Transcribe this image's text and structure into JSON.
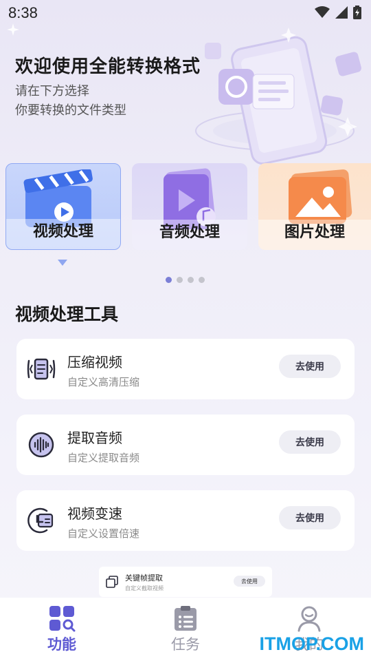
{
  "status_bar": {
    "time": "8:38"
  },
  "hero": {
    "title": "欢迎使用全能转换格式",
    "subtitle_line1": "请在下方选择",
    "subtitle_line2": "你要转换的文件类型"
  },
  "categories": [
    {
      "label": "视频处理",
      "selected": true
    },
    {
      "label": "音频处理",
      "selected": false
    },
    {
      "label": "图片处理",
      "selected": false
    }
  ],
  "carousel": {
    "page_count": 4,
    "active_index": 0
  },
  "section": {
    "title": "视频处理工具"
  },
  "tools": [
    {
      "name": "压缩视频",
      "desc": "自定义高清压缩",
      "button": "去使用",
      "icon": "compress-video-icon"
    },
    {
      "name": "提取音频",
      "desc": "自定义提取音频",
      "button": "去使用",
      "icon": "audio-wave-icon"
    },
    {
      "name": "视频变速",
      "desc": "自定义设置倍速",
      "button": "去使用",
      "icon": "speed-icon"
    }
  ],
  "mini_tool": {
    "name": "关键帧提取",
    "desc": "自定义截取视频",
    "button": "去使用",
    "icon": "keyframe-icon"
  },
  "nav": [
    {
      "label": "功能",
      "icon": "grid-search-icon",
      "active": true
    },
    {
      "label": "任务",
      "icon": "clipboard-list-icon",
      "active": false
    },
    {
      "label": "我的",
      "icon": "user-icon",
      "active": false
    }
  ],
  "colors": {
    "accent": "#5e5ad3",
    "inactive": "#9a9aa8",
    "watermark": "#19a1e6"
  },
  "watermark": "ITMOP.COM"
}
